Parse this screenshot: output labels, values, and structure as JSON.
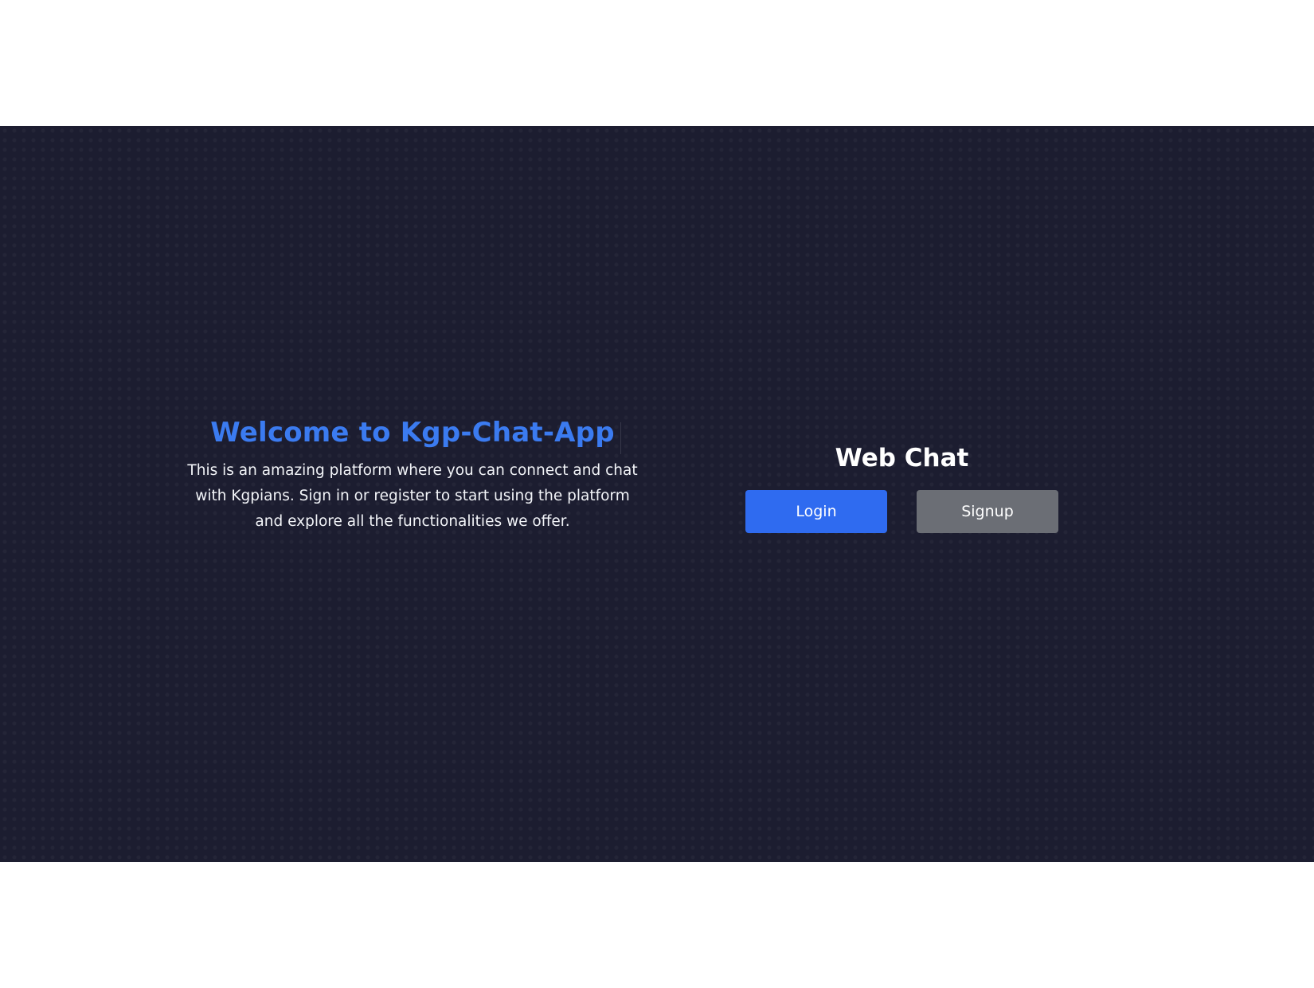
{
  "welcome": {
    "title": "Welcome to Kgp-Chat-App",
    "description": "This is an amazing platform where you can connect and chat with Kgpians. Sign in or register to start using the platform and explore all the functionalities we offer."
  },
  "auth": {
    "title": "Web Chat",
    "login_label": "Login",
    "signup_label": "Signup"
  },
  "colors": {
    "background": "#1c1d30",
    "accent": "#3b7bf0",
    "login_button": "#2f6bf0",
    "signup_button": "#6b6e75"
  }
}
